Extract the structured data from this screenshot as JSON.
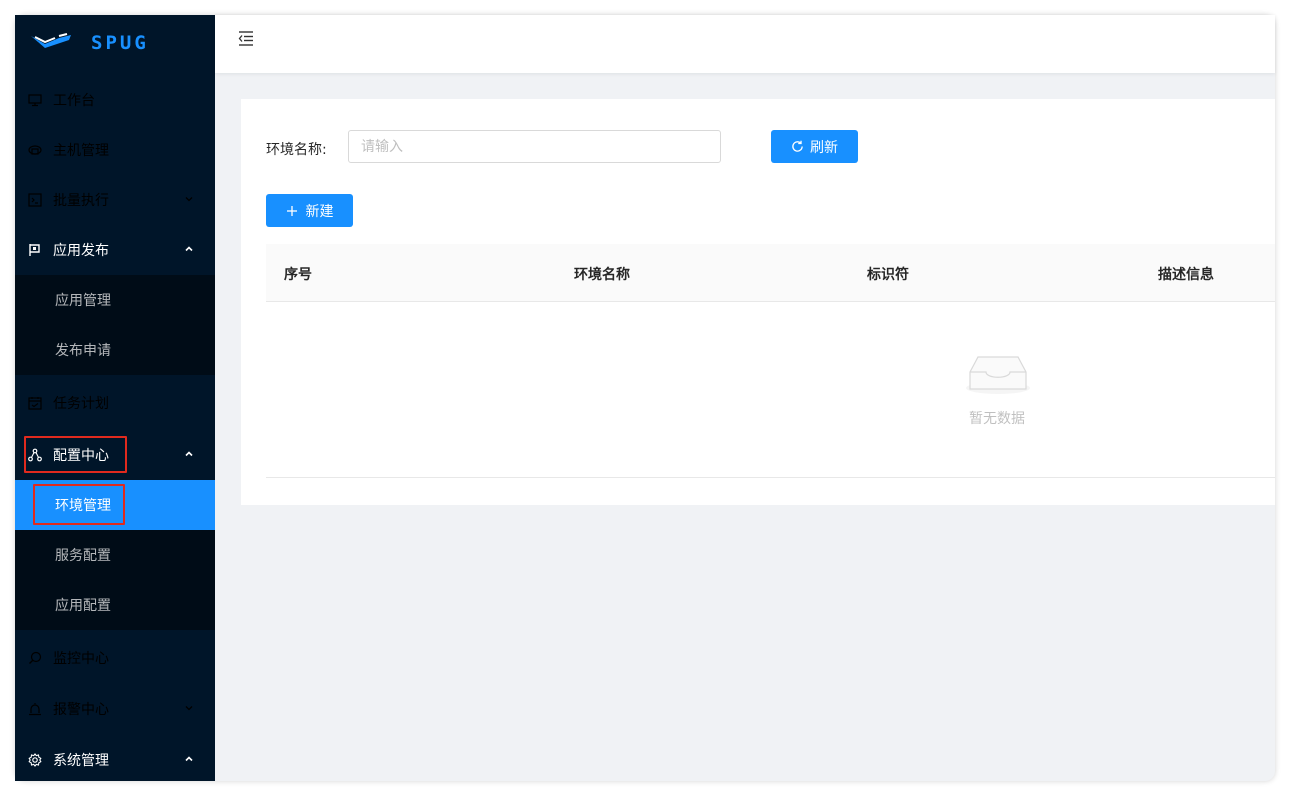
{
  "app": {
    "logo_text": "SPUG"
  },
  "sidebar": {
    "items": {
      "workbench": "工作台",
      "hosts": "主机管理",
      "batch": "批量执行",
      "deploy": "应用发布",
      "deploy_app": "应用管理",
      "deploy_request": "发布申请",
      "schedule": "任务计划",
      "config": "配置中心",
      "config_env": "环境管理",
      "config_service": "服务配置",
      "config_app": "应用配置",
      "monitor": "监控中心",
      "alarm": "报警中心",
      "system": "系统管理"
    }
  },
  "search": {
    "label": "环境名称:",
    "placeholder": "请输入"
  },
  "buttons": {
    "refresh": "刷新",
    "add": "新建"
  },
  "table": {
    "columns": [
      "序号",
      "环境名称",
      "标识符",
      "描述信息"
    ],
    "empty_text": "暂无数据"
  },
  "colors": {
    "sidebar_bg": "#001529",
    "primary": "#1890ff",
    "highlight": "#e02a1e"
  }
}
